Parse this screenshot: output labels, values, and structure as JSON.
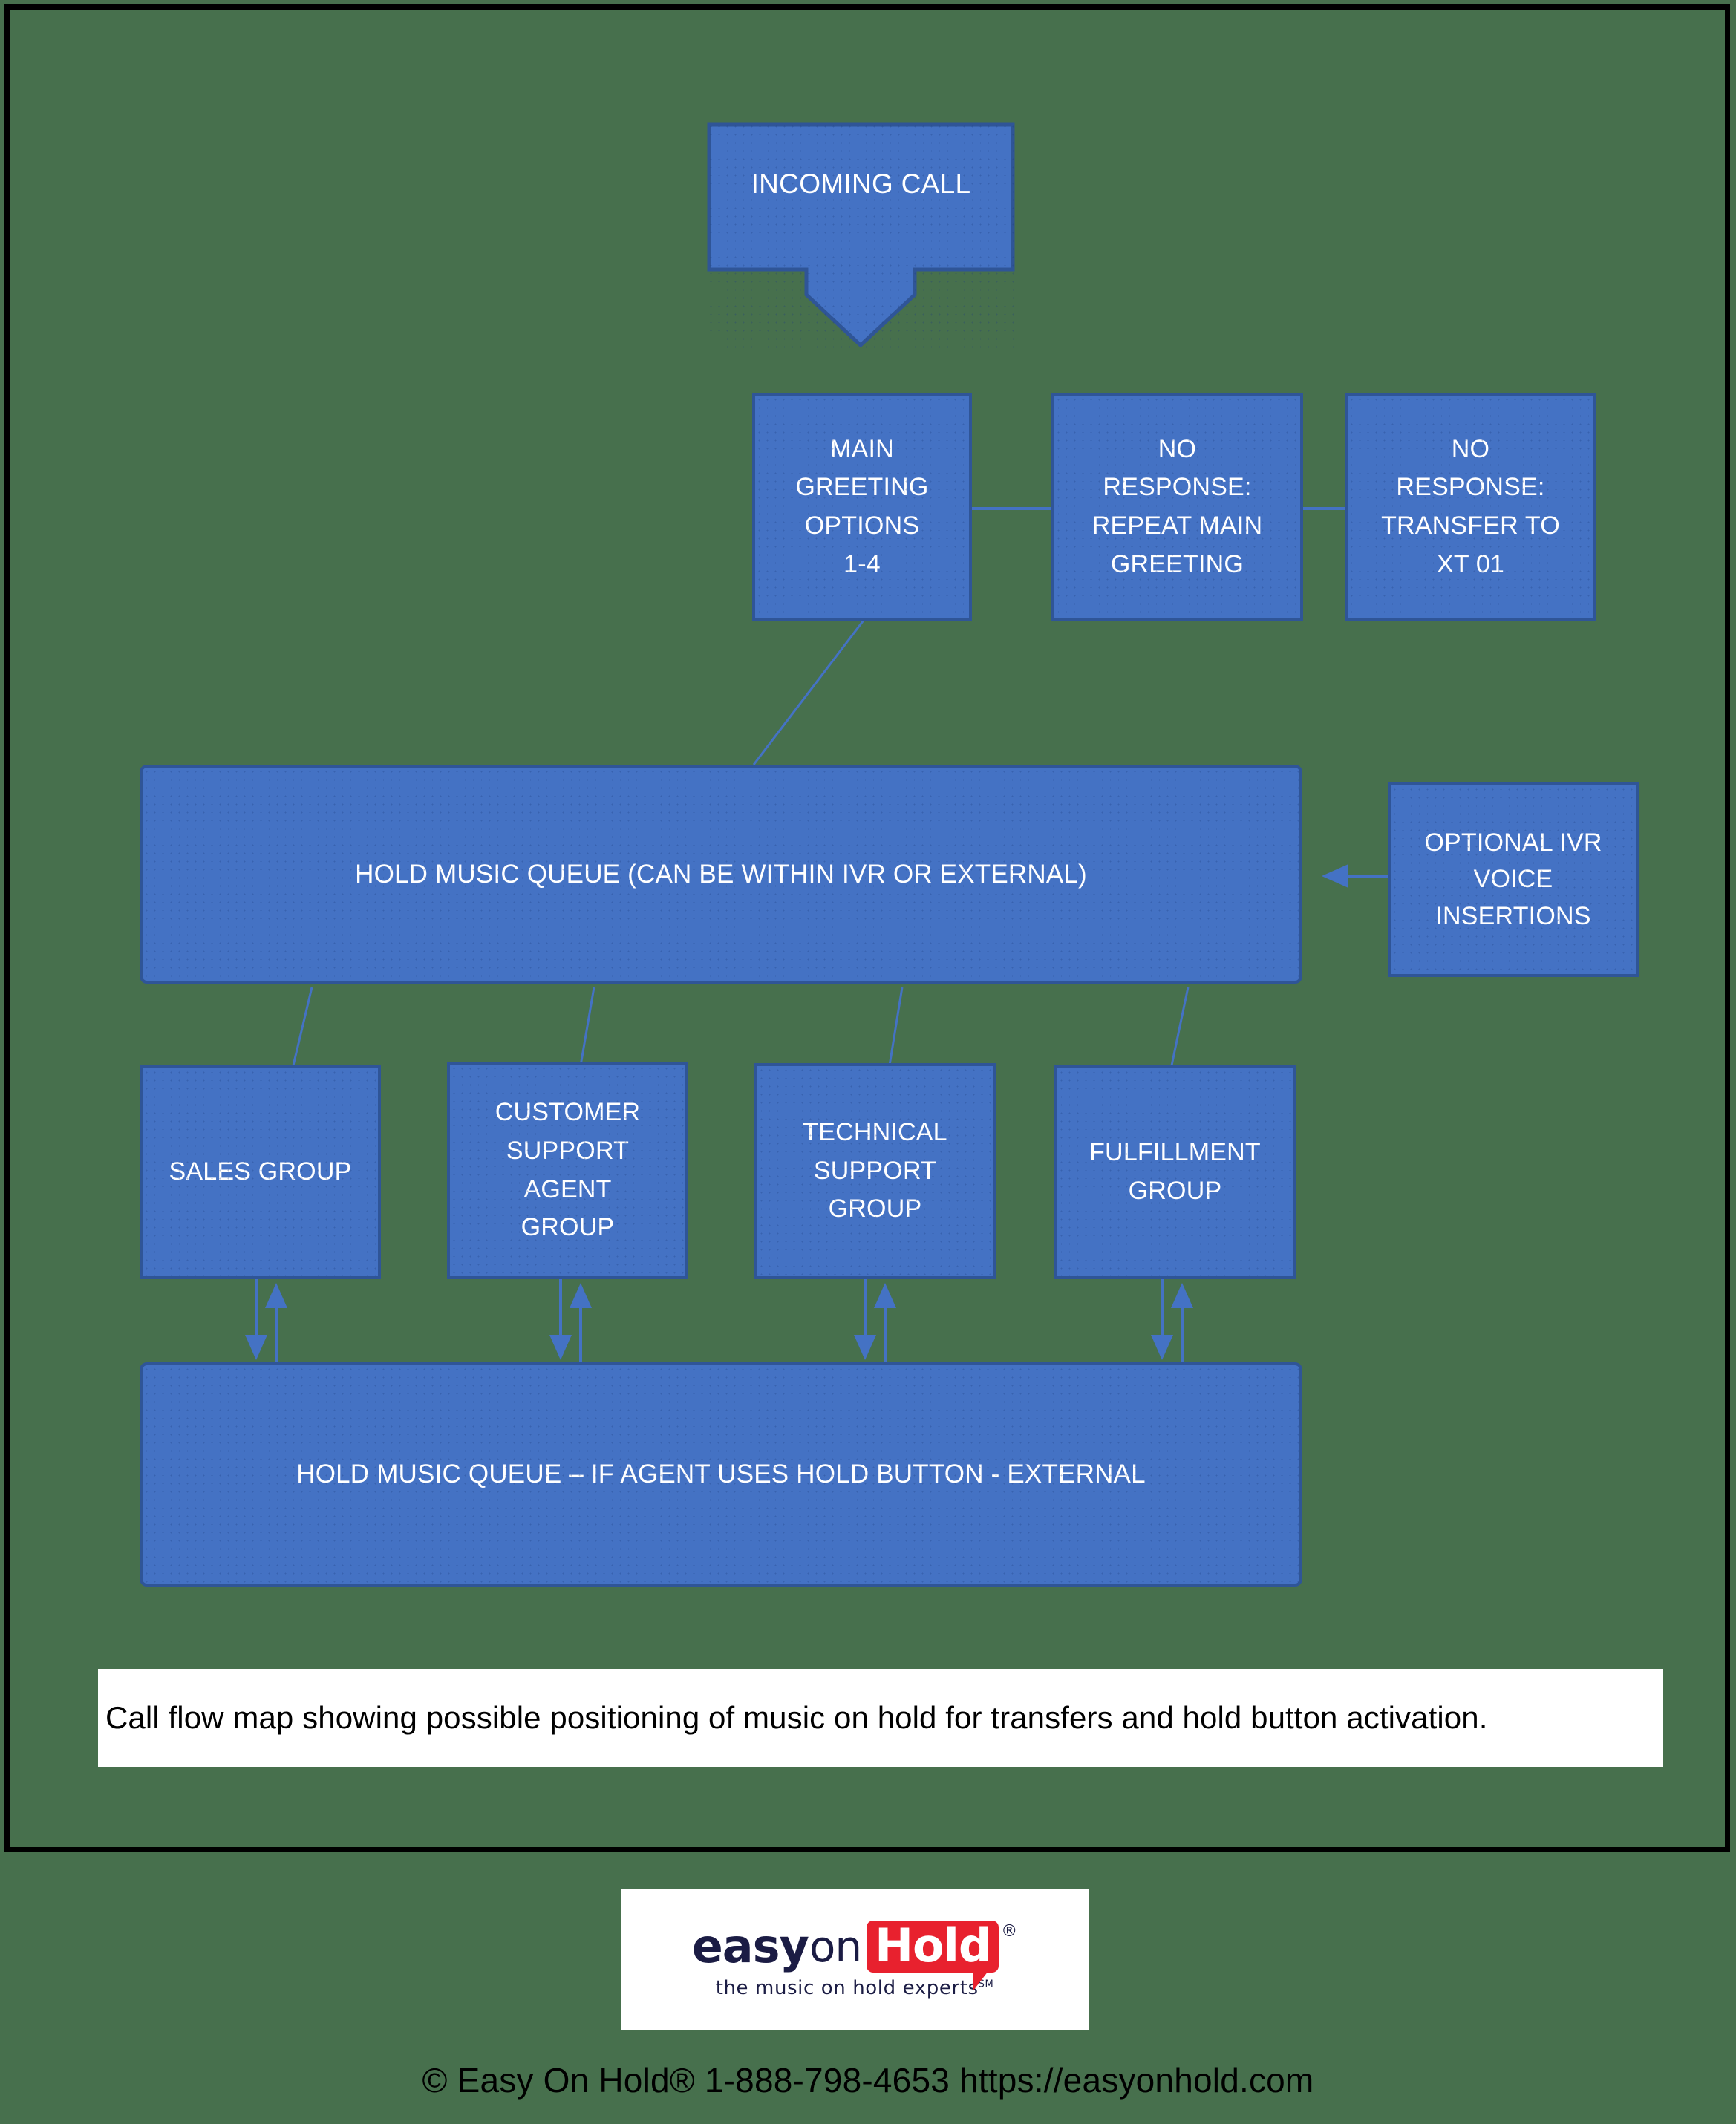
{
  "diagram": {
    "background_color": "#47704D",
    "box_fill_color": "#4472C4",
    "box_border_color": "#2F5597",
    "nodes": {
      "incoming_call": "INCOMING CALL",
      "main_greeting": "MAIN\nGREETING\nOPTIONS\n1-4",
      "no_response_repeat": "NO\nRESPONSE:\nREPEAT MAIN\nGREETING",
      "no_response_transfer": "NO\nRESPONSE:\nTRANSFER TO\nXT 01",
      "hold_music_queue_top": "HOLD MUSIC QUEUE (CAN BE WITHIN IVR OR EXTERNAL)",
      "optional_ivr": "OPTIONAL IVR\nVOICE\nINSERTIONS",
      "sales_group": "SALES GROUP",
      "customer_support_agent_group": "CUSTOMER\nSUPPORT\nAGENT\nGROUP",
      "technical_support_group": "TECHNICAL\nSUPPORT\nGROUP",
      "fulfillment_group": "FULFILLMENT\nGROUP",
      "hold_music_queue_bottom": "HOLD MUSIC QUEUE – IF AGENT USES HOLD BUTTON - EXTERNAL"
    }
  },
  "caption": {
    "text": "Call flow map showing possible positioning of music on hold for transfers and hold button activation."
  },
  "logo": {
    "easy": "easy",
    "on": "on",
    "hold": "Hold",
    "registered": "®",
    "tagline": "the music on hold experts",
    "tagline_sup": "SM",
    "bubble_color": "#e8212e",
    "text_color": "#1b1c44"
  },
  "footer": {
    "text": "© Easy On Hold® 1-888-798-4653  https://easyonhold.com"
  }
}
